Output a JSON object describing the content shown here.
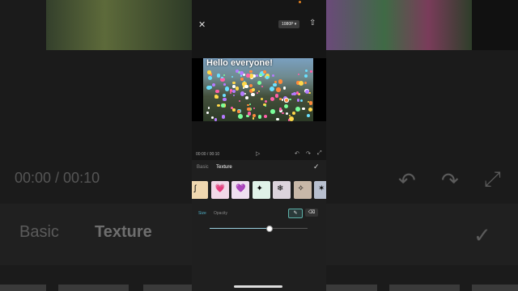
{
  "toolbar": {
    "resolution": "1080P ▾",
    "close_icon": "close-icon",
    "export_icon": "export-icon"
  },
  "preview": {
    "overlay_text": "Hello everyone!"
  },
  "playback": {
    "current_time": "00:00",
    "separator": "/",
    "total_time": "00:10",
    "play_icon": "play-icon",
    "undo_icon": "undo-icon",
    "redo_icon": "redo-icon",
    "fullscreen_icon": "fullscreen-icon"
  },
  "panel": {
    "tabs": [
      {
        "label": "Basic",
        "active": false
      },
      {
        "label": "Texture",
        "active": true
      }
    ],
    "confirm_icon": "check-icon",
    "textures": [
      {
        "name": "scribble-brush",
        "glyph": "ʃ"
      },
      {
        "name": "pink-hearts",
        "glyph": "💗"
      },
      {
        "name": "purple-hearts",
        "glyph": "💜"
      },
      {
        "name": "green-sparkles",
        "glyph": "✦"
      },
      {
        "name": "soft-flakes",
        "glyph": "❄"
      },
      {
        "name": "gold-dots",
        "glyph": "✧"
      },
      {
        "name": "blue-stars",
        "glyph": "✶"
      }
    ],
    "subtabs": [
      {
        "label": "Size",
        "active": true
      },
      {
        "label": "Opacity",
        "active": false
      }
    ],
    "tools": [
      {
        "name": "brush",
        "icon": "brush-icon",
        "active": true
      },
      {
        "name": "eraser",
        "icon": "eraser-icon",
        "active": false
      }
    ],
    "size_value": 0.6
  },
  "background": {
    "time": "00:00 / 00:10",
    "basic": "Basic",
    "texture": "Texture"
  },
  "colors": {
    "accent": "#4fb0c8",
    "tool_border": "#5db1a8"
  }
}
